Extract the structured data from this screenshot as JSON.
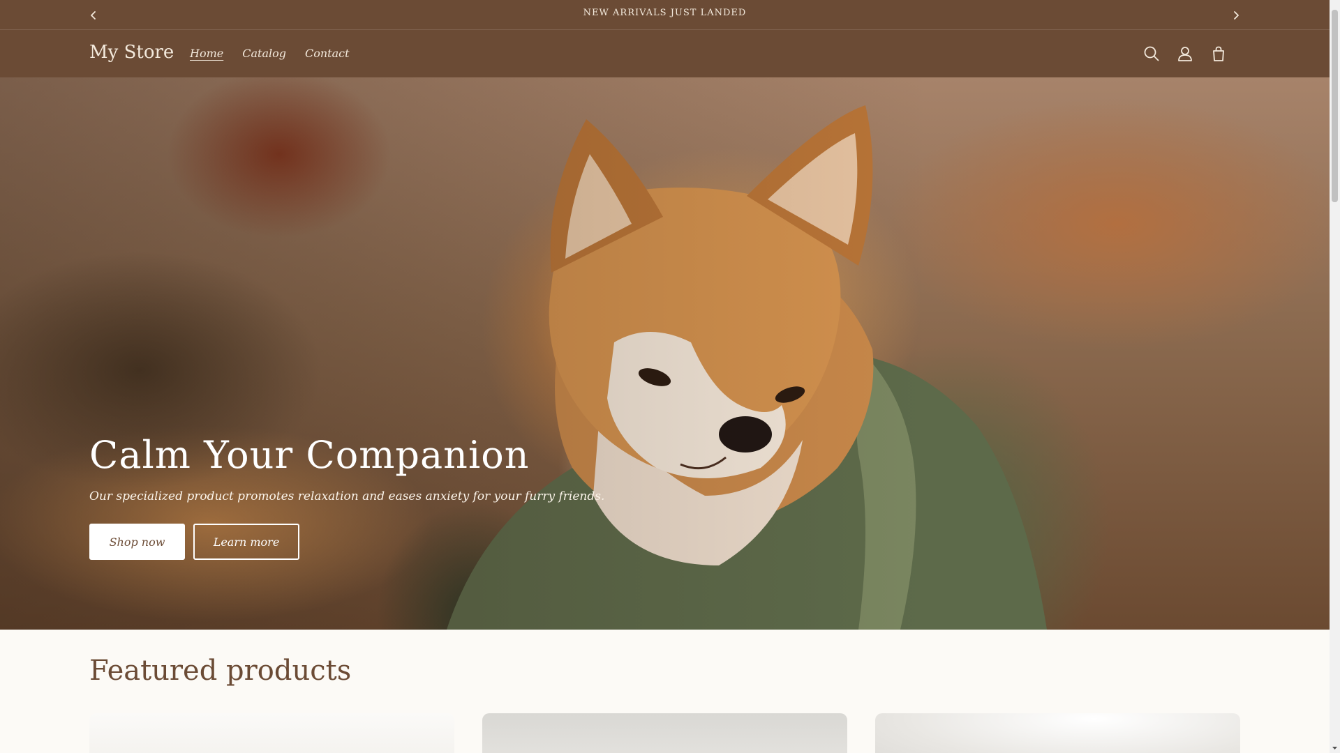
{
  "announcement": {
    "text": "NEW ARRIVALS JUST LANDED",
    "prev_icon": "chevron-left-icon",
    "next_icon": "chevron-right-icon"
  },
  "header": {
    "logo": "My Store",
    "nav": [
      {
        "label": "Home",
        "active": true
      },
      {
        "label": "Catalog",
        "active": false
      },
      {
        "label": "Contact",
        "active": false
      }
    ],
    "icons": [
      "search-icon",
      "account-icon",
      "cart-icon"
    ]
  },
  "hero": {
    "title": "Calm Your Companion",
    "subtitle": "Our specialized product promotes relaxation and eases anxiety for your furry friends.",
    "primary_button": "Shop now",
    "secondary_button": "Learn more"
  },
  "featured": {
    "title": "Featured products"
  },
  "colors": {
    "brand": "#6b4b35",
    "header_text": "#f3e9dc",
    "background": "#fcfaf6",
    "button_bg": "#ffffff"
  }
}
